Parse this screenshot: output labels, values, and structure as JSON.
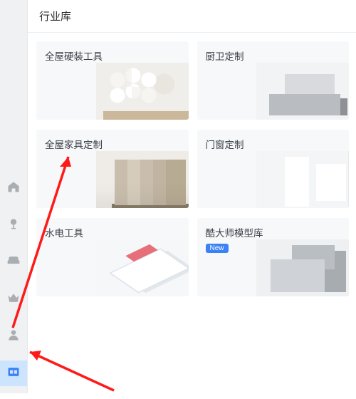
{
  "header": {
    "title": "行业库"
  },
  "cards": [
    {
      "title": "全屋硬装工具",
      "thumb": "t0"
    },
    {
      "title": "厨卫定制",
      "thumb": "t1"
    },
    {
      "title": "全屋家具定制",
      "thumb": "t2"
    },
    {
      "title": "门窗定制",
      "thumb": "t3"
    },
    {
      "title": "水电工具",
      "thumb": "t4"
    },
    {
      "title": "酷大师模型库",
      "thumb": "t5",
      "badge": "New"
    }
  ],
  "rail": [
    {
      "icon": "house-icon",
      "active": false
    },
    {
      "icon": "lamp-icon",
      "active": false
    },
    {
      "icon": "sofa-icon",
      "active": false
    },
    {
      "icon": "crown-icon",
      "active": false
    },
    {
      "icon": "user-icon",
      "active": false
    },
    {
      "icon": "library-icon",
      "active": true
    }
  ],
  "colors": {
    "accent": "#3b82f6",
    "arrow": "#ff1a1a"
  }
}
